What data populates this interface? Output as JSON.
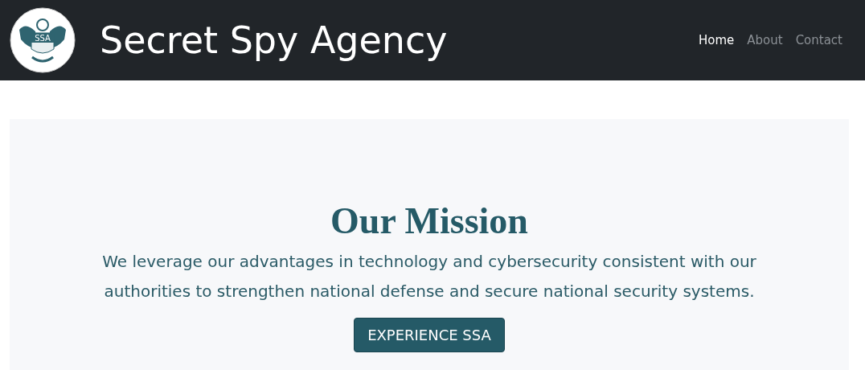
{
  "header": {
    "logo_text": "SSA",
    "title": "Secret Spy Agency",
    "nav": [
      {
        "label": "Home",
        "selected": true
      },
      {
        "label": "About",
        "selected": false
      },
      {
        "label": "Contact",
        "selected": false
      }
    ]
  },
  "hero": {
    "heading": "Our Mission",
    "text": "We leverage our advantages in technology and cybersecurity consistent with our authorities to strengthen national defense and secure national security systems.",
    "button": "EXPERIENCE SSA"
  }
}
